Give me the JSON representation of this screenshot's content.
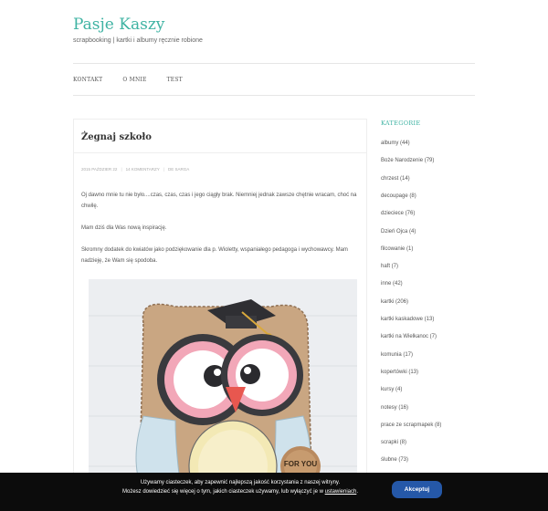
{
  "site": {
    "title": "Pasje Kaszy",
    "tagline": "scrapbooking | kartki i albumy ręcznie robione"
  },
  "nav": {
    "items": [
      "KONTAKT",
      "O MNIE",
      "TEST"
    ]
  },
  "post": {
    "title": "Żegnaj szkoło",
    "meta": {
      "date": "2015 PAŹDZIER 22",
      "comments": "14 KOMENTARZY",
      "category": "DE SARGA"
    },
    "paragraphs": [
      "Oj dawno mnie tu nie było....czas, czas, czas i jego ciągły brak. Niemniej jednak zawsze chętnie wracam, choć na chwilę.",
      "Mam dziś dla Was nową inspirację.",
      "Skromny dodatek do kwiatów jako podziękowanie dla p. Wioletty, wspaniałego pedagoga i wychowawcy. Mam nadzieję, że Wam się spodoba."
    ],
    "photo_label": "FOR YOU"
  },
  "sidebar": {
    "heading": "KATEGORIE",
    "categories": [
      "albumy (44)",
      "Boże Narodzenie (79)",
      "chrzest (14)",
      "decoupage (8)",
      "dzieciece (76)",
      "Dzień Ojca (4)",
      "filcowanie (1)",
      "haft (7)",
      "inne (42)",
      "kartki (206)",
      "kartki kaskadowe (13)",
      "kartki na Wielkanoc (7)",
      "komunia (17)",
      "kopertówki (13)",
      "kursy (4)",
      "notesy (16)",
      "prace ze scrapmapek (8)",
      "scrapki (8)",
      "ślubne (73)"
    ]
  },
  "cookie": {
    "line1": "Używamy ciasteczek, aby zapewnić najlepszą jakość korzystania z naszej witryny.",
    "line2_prefix": "Możesz dowiedzieć się więcej o tym, jakich ciasteczek używamy, lub wyłączyć je w ",
    "line2_link": "ustawieniach",
    "line2_suffix": ".",
    "accept_label": "Akceptuj"
  },
  "colors": {
    "accent": "#3fb3a3",
    "cookie_bg": "#0c0c0c",
    "accept_bg": "#2558a8"
  }
}
